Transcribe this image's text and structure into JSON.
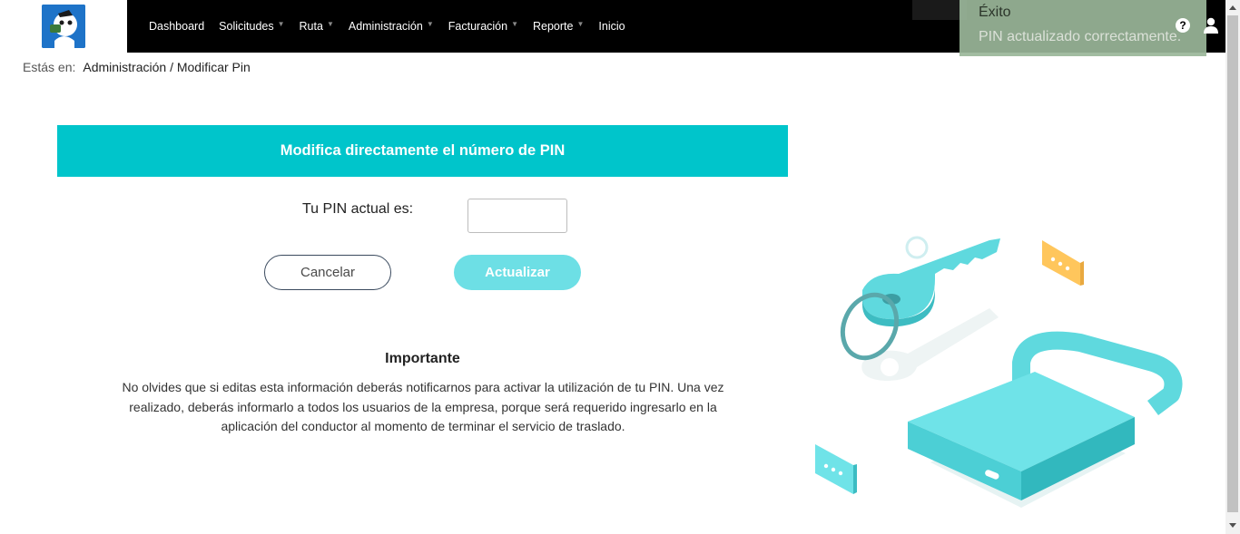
{
  "nav": {
    "items": [
      {
        "label": "Dashboard",
        "has_caret": false
      },
      {
        "label": "Solicitudes",
        "has_caret": true
      },
      {
        "label": "Ruta",
        "has_caret": true
      },
      {
        "label": "Administración",
        "has_caret": true
      },
      {
        "label": "Facturación",
        "has_caret": true
      },
      {
        "label": "Reporte",
        "has_caret": true
      },
      {
        "label": "Inicio",
        "has_caret": false
      }
    ],
    "caret": "▼"
  },
  "toast": {
    "title": "Éxito",
    "message": "PIN actualizado correctamente."
  },
  "header_icons": {
    "help": "?",
    "help_icon": "question-circle-icon",
    "user_icon": "user-icon"
  },
  "breadcrumb": {
    "label": "Estás en:",
    "path": "Administración / Modificar Pin"
  },
  "form": {
    "banner_title": "Modifica directamente el número de PIN",
    "pin_label": "Tu PIN actual es:",
    "pin_value": "",
    "cancel_label": "Cancelar",
    "update_label": "Actualizar"
  },
  "important": {
    "title": "Importante",
    "text": "No olvides que si editas esta información deberás notificarnos para activar la utilización de tu PIN. Una vez realizado, deberás informarlo a todos los usuarios de la empresa, porque será requerido ingresarlo en la aplicación del conductor al momento de terminar el servicio de traslado."
  },
  "colors": {
    "accent": "#00c5cb",
    "button_update": "#6ddfe5",
    "toast_bg": "#9bb79a",
    "topbar": "#000000"
  }
}
